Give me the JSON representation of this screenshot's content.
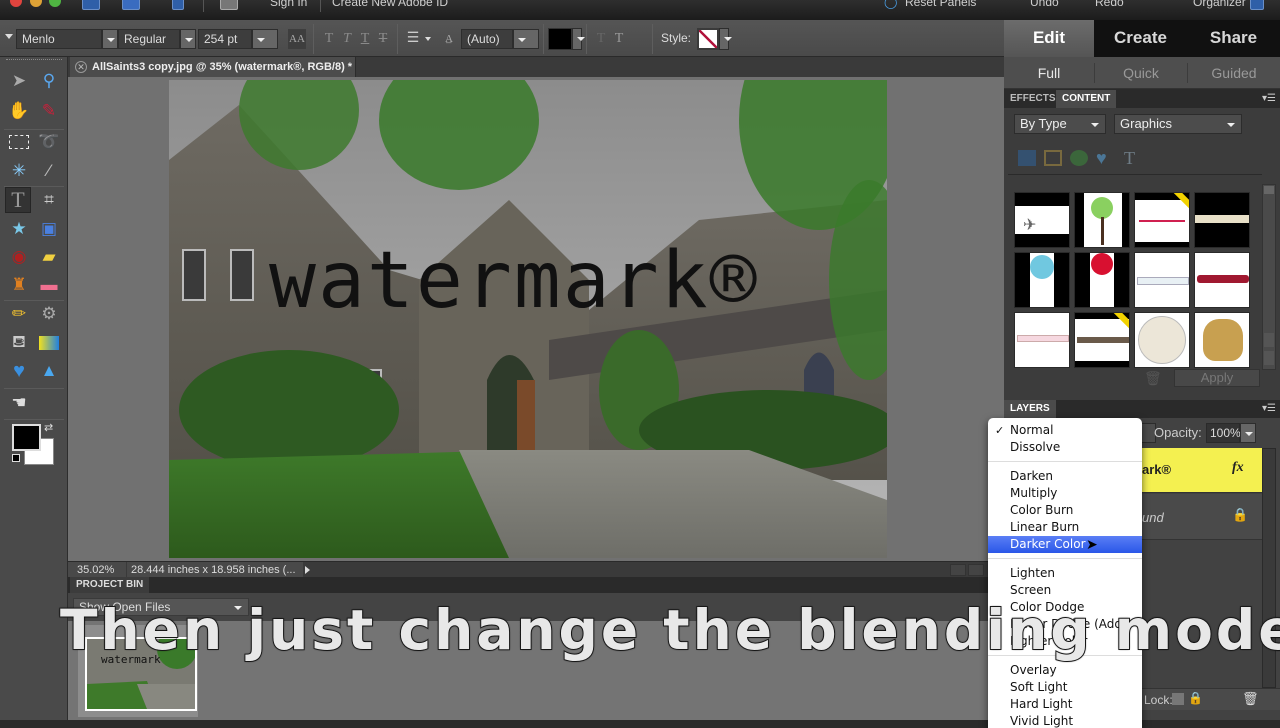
{
  "menubar": {
    "sign_in": "Sign In",
    "create_id": "Create New Adobe ID",
    "reset_panels": "Reset Panels",
    "undo": "Undo",
    "redo": "Redo",
    "organizer": "Organizer"
  },
  "options_bar": {
    "font_family": "Menlo",
    "font_style": "Regular",
    "font_size": "254 pt",
    "leading": "(Auto)",
    "style_label": "Style:",
    "text_color": "#000000"
  },
  "mode_tabs": [
    {
      "label": "Edit",
      "active": true
    },
    {
      "label": "Create",
      "active": false
    },
    {
      "label": "Share",
      "active": false
    }
  ],
  "sub_tabs": [
    {
      "label": "Full",
      "active": true
    },
    {
      "label": "Quick",
      "active": false
    },
    {
      "label": "Guided",
      "active": false
    }
  ],
  "document": {
    "tab_title": "AllSaints3 copy.jpg @ 35% (watermark®, RGB/8) *",
    "watermark_text": "watermark®",
    "zoom": "35.02%",
    "dimensions": "28.444 inches x 18.958 inches (..."
  },
  "toolbox": {
    "tools": [
      "move-tool",
      "zoom-tool",
      "hand-tool",
      "eyedropper-tool",
      "marquee-tool",
      "lasso-tool",
      "magic-wand-tool",
      "quick-selection-tool",
      "type-tool",
      "crop-tool",
      "cookie-cutter-tool",
      "recompose-tool",
      "red-eye-tool",
      "healing-brush-tool",
      "clone-stamp-tool",
      "eraser-tool",
      "pencil-tool",
      "smart-brush-tool",
      "paint-bucket-tool",
      "gradient-tool",
      "custom-shape-tool",
      "sharpen-tool",
      "smudge-tool"
    ],
    "selected": "type-tool",
    "foreground_color": "#000000",
    "background_color": "#ffffff"
  },
  "project_bin": {
    "title": "PROJECT BIN",
    "filter": "Show Open Files",
    "thumb_text": "watermark"
  },
  "content_panel": {
    "tabs": [
      {
        "label": "EFFECTS",
        "active": false
      },
      {
        "label": "CONTENT",
        "active": true
      }
    ],
    "sort_by": "By Type",
    "category": "Graphics",
    "items": [
      "airplane",
      "tree",
      "arrow",
      "border-strip",
      "blue-balloon",
      "red-balloon",
      "frame-bar-light",
      "frame-bar-red",
      "frame-bar-pink",
      "name-banner",
      "baseball",
      "baseball-glove"
    ],
    "apply_label": "Apply"
  },
  "layers_panel": {
    "title": "LAYERS",
    "opacity_label": "Opacity:",
    "opacity_value": "100%",
    "layers": [
      {
        "name": "watermark®",
        "visible_text": "ark®",
        "active": true,
        "has_fx": true
      },
      {
        "name": "Background",
        "visible_text": "und",
        "locked": true
      }
    ],
    "lock_label": "Lock:"
  },
  "blend_menu": {
    "groups": [
      [
        "Normal",
        "Dissolve"
      ],
      [
        "Darken",
        "Multiply",
        "Color Burn",
        "Linear Burn",
        "Darker Color"
      ],
      [
        "Lighten",
        "Screen",
        "Color Dodge",
        "Linear Dodge (Add)",
        "Lighter Color"
      ],
      [
        "Overlay",
        "Soft Light",
        "Hard Light",
        "Vivid Light"
      ]
    ],
    "checked": "Normal",
    "highlighted": "Darker Color"
  },
  "caption": "Then just change the blending mode"
}
